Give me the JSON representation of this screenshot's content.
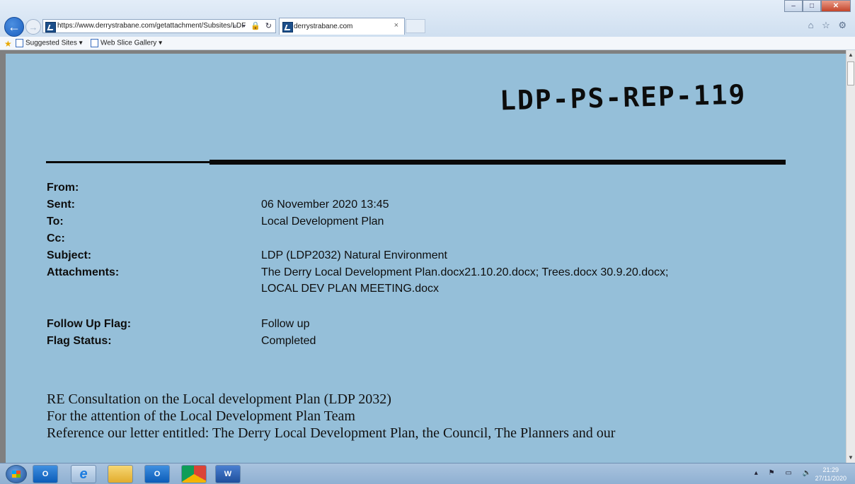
{
  "browser": {
    "url": "https://www.derrystrabane.com/getattachment/Subsites/LDF",
    "tab_title": "derrystrabane.com",
    "tab_close": "×",
    "address_tools": "⌕ ▾ 🔒 ↻",
    "window_buttons": {
      "minimize": "–",
      "maximize": "□",
      "close": "✕"
    },
    "right_icons": "⌂ ☆ ⚙"
  },
  "favorites": {
    "suggested": "Suggested Sites ▾",
    "web_slice": "Web Slice Gallery ▾"
  },
  "document": {
    "stamp": "LDP-PS-REP-119",
    "headers": [
      {
        "label": "From:",
        "value": ""
      },
      {
        "label": "Sent:",
        "value": "06 November 2020 13:45"
      },
      {
        "label": "To:",
        "value": "Local Development Plan"
      },
      {
        "label": "Cc:",
        "value": ""
      },
      {
        "label": "Subject:",
        "value": "LDP (LDP2032) Natural Environment"
      },
      {
        "label": "Attachments:",
        "value": "The Derry Local Development Plan.docx21.10.20.docx; Trees.docx 30.9.20.docx;"
      },
      {
        "label": "",
        "value": "LOCAL DEV PLAN MEETING.docx"
      },
      {
        "label": "Follow Up Flag:",
        "value": "Follow up"
      },
      {
        "label": "Flag Status:",
        "value": "Completed"
      }
    ],
    "body_lines": [
      "RE Consultation on the Local development Plan (LDP 2032)",
      "For the attention of the Local Development Plan Team",
      "Reference our letter entitled: The Derry Local Development Plan, the Council, The Planners and our"
    ]
  },
  "taskbar": {
    "apps": [
      "outlook-icon",
      "internet-explorer-icon",
      "file-explorer-icon",
      "outlook-app-icon",
      "chrome-icon",
      "word-icon"
    ],
    "app_labels": [
      "O",
      "e",
      "",
      "O",
      "",
      "W"
    ],
    "tray": "▴ ⚑ ▭ 🔈",
    "time": "21:29",
    "date": "27/11/2020"
  }
}
